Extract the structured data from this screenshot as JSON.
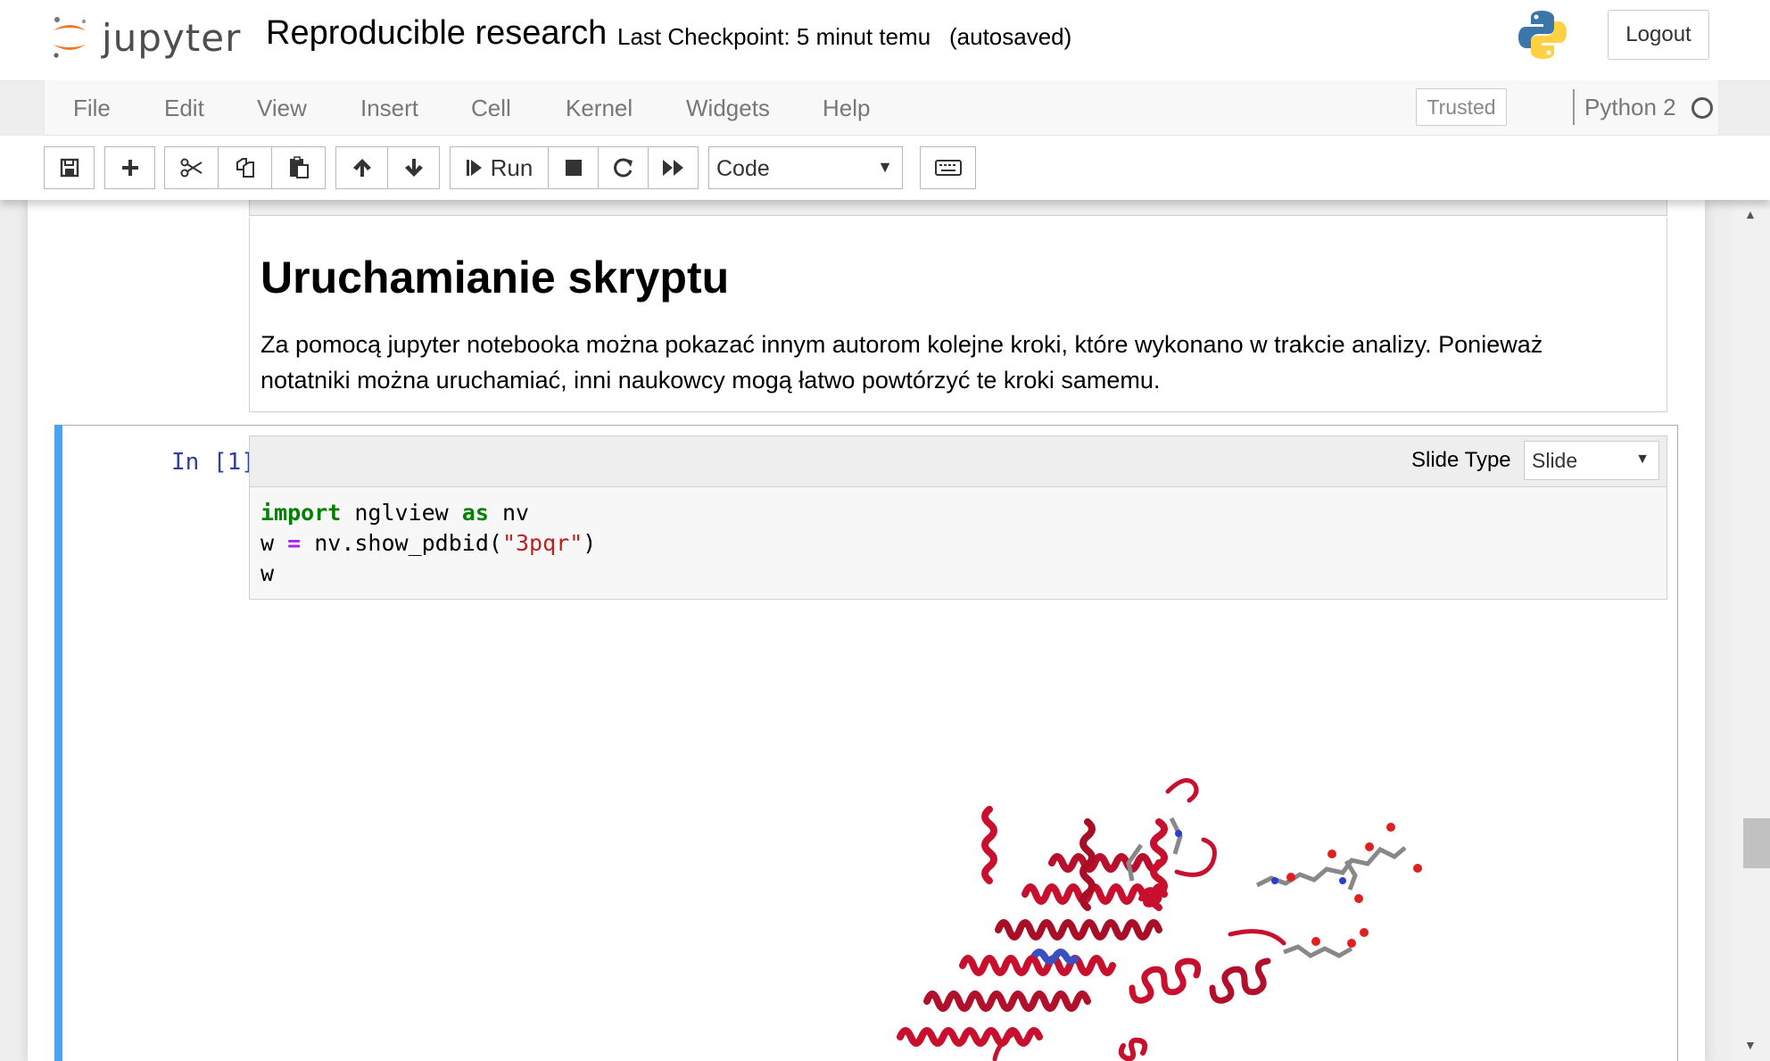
{
  "header": {
    "logo_text": "jupyter",
    "notebook_title": "Reproducible research",
    "checkpoint": "Last Checkpoint: 5 minut temu",
    "autosave_status": "(autosaved)",
    "logout_label": "Logout"
  },
  "menubar": {
    "items": [
      "File",
      "Edit",
      "View",
      "Insert",
      "Cell",
      "Kernel",
      "Widgets",
      "Help"
    ],
    "trusted_label": "Trusted",
    "kernel_name": "Python 2"
  },
  "toolbar": {
    "run_label": "Run",
    "cell_type": "Code",
    "buttons": [
      "save-icon",
      "plus-icon",
      "scissors-icon",
      "copy-icon",
      "paste-icon",
      "arrow-up-icon",
      "arrow-down-icon",
      "run-icon",
      "stop-icon",
      "restart-icon",
      "fast-forward-icon",
      "keyboard-icon"
    ]
  },
  "markdown_cell": {
    "heading": "Uruchamianie skryptu",
    "paragraph": "Za pomocą jupyter notebooka można pokazać innym autorom kolejne kroki, które wykonano w trakcie analizy. Ponieważ notatniki można uruchamiać, inni naukowcy mogą łatwo powtórzyć te kroki samemu."
  },
  "code_cell": {
    "prompt": "In [1]:",
    "slide_type_label": "Slide Type",
    "slide_type_value": "Slide",
    "code": {
      "line1": {
        "kw1": "import",
        "mod": " nglview ",
        "kw2": "as",
        "alias": " nv"
      },
      "line2": {
        "var": "w ",
        "op": "=",
        "call": " nv.show_pdbid(",
        "str": "\"3pqr\"",
        "close": ")"
      },
      "line3": "w"
    }
  },
  "colors": {
    "selected_cell_bar": "#42a5f5",
    "prompt": "#303f9f",
    "keyword": "#008000",
    "string": "#ba2121",
    "protein_ribbon": "#c8102e"
  }
}
